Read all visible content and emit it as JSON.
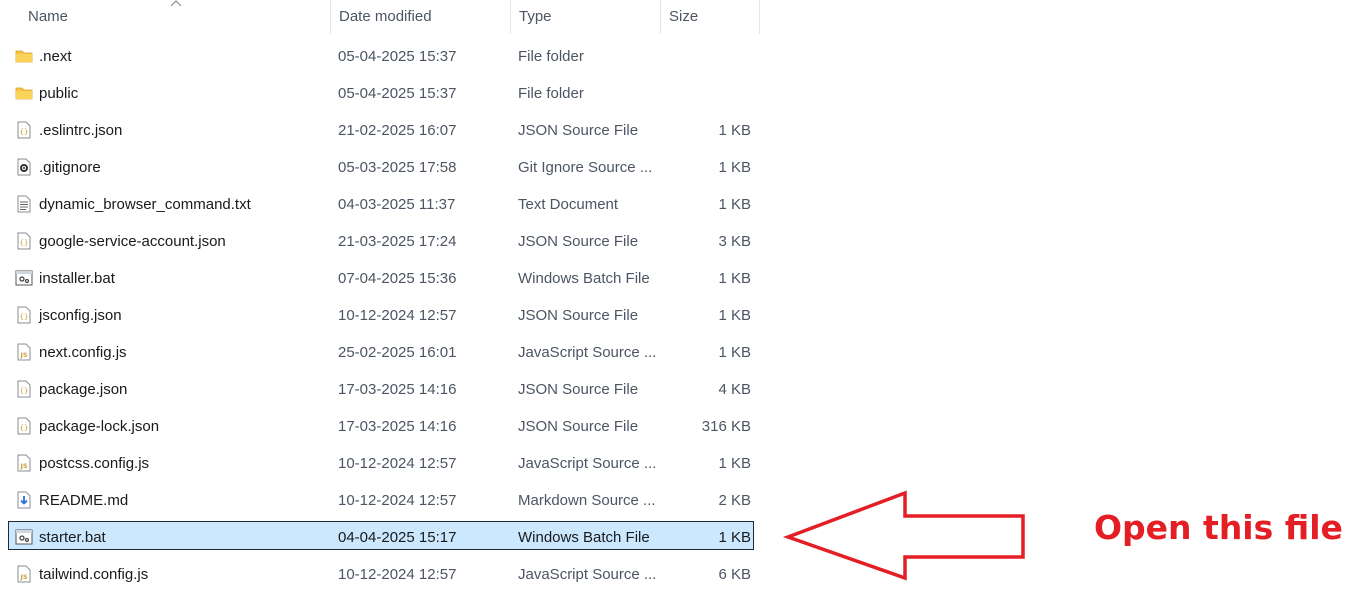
{
  "columns": {
    "name": "Name",
    "date": "Date modified",
    "type": "Type",
    "size": "Size"
  },
  "files": [
    {
      "name": ".next",
      "date": "05-04-2025 15:37",
      "type": "File folder",
      "size": "",
      "icon": "folder-icon"
    },
    {
      "name": "public",
      "date": "05-04-2025 15:37",
      "type": "File folder",
      "size": "",
      "icon": "folder-icon"
    },
    {
      "name": ".eslintrc.json",
      "date": "21-02-2025 16:07",
      "type": "JSON Source File",
      "size": "1 KB",
      "icon": "json-file-icon"
    },
    {
      "name": ".gitignore",
      "date": "05-03-2025 17:58",
      "type": "Git Ignore Source ...",
      "size": "1 KB",
      "icon": "gear-file-icon"
    },
    {
      "name": "dynamic_browser_command.txt",
      "date": "04-03-2025 11:37",
      "type": "Text Document",
      "size": "1 KB",
      "icon": "text-file-icon"
    },
    {
      "name": "google-service-account.json",
      "date": "21-03-2025 17:24",
      "type": "JSON Source File",
      "size": "3 KB",
      "icon": "json-file-icon"
    },
    {
      "name": "installer.bat",
      "date": "07-04-2025 15:36",
      "type": "Windows Batch File",
      "size": "1 KB",
      "icon": "batch-file-icon"
    },
    {
      "name": "jsconfig.json",
      "date": "10-12-2024 12:57",
      "type": "JSON Source File",
      "size": "1 KB",
      "icon": "json-file-icon"
    },
    {
      "name": "next.config.js",
      "date": "25-02-2025 16:01",
      "type": "JavaScript Source ...",
      "size": "1 KB",
      "icon": "js-file-icon"
    },
    {
      "name": "package.json",
      "date": "17-03-2025 14:16",
      "type": "JSON Source File",
      "size": "4 KB",
      "icon": "json-file-icon"
    },
    {
      "name": "package-lock.json",
      "date": "17-03-2025 14:16",
      "type": "JSON Source File",
      "size": "316 KB",
      "icon": "json-file-icon"
    },
    {
      "name": "postcss.config.js",
      "date": "10-12-2024 12:57",
      "type": "JavaScript Source ...",
      "size": "1 KB",
      "icon": "js-file-icon"
    },
    {
      "name": "README.md",
      "date": "10-12-2024 12:57",
      "type": "Markdown Source ...",
      "size": "2 KB",
      "icon": "markdown-file-icon"
    },
    {
      "name": "starter.bat",
      "date": "04-04-2025 15:17",
      "type": "Windows Batch File",
      "size": "1 KB",
      "icon": "batch-file-icon",
      "selected": true
    },
    {
      "name": "tailwind.config.js",
      "date": "10-12-2024 12:57",
      "type": "JavaScript Source ...",
      "size": "6 KB",
      "icon": "js-file-icon"
    }
  ],
  "annotation": {
    "label": "Open this file",
    "color": "#e31e24"
  },
  "colors": {
    "selection_fill": "#cce8ff",
    "selection_border": "#1e2a36",
    "folder": "#f6c344",
    "muted_text": "#4c5563"
  }
}
